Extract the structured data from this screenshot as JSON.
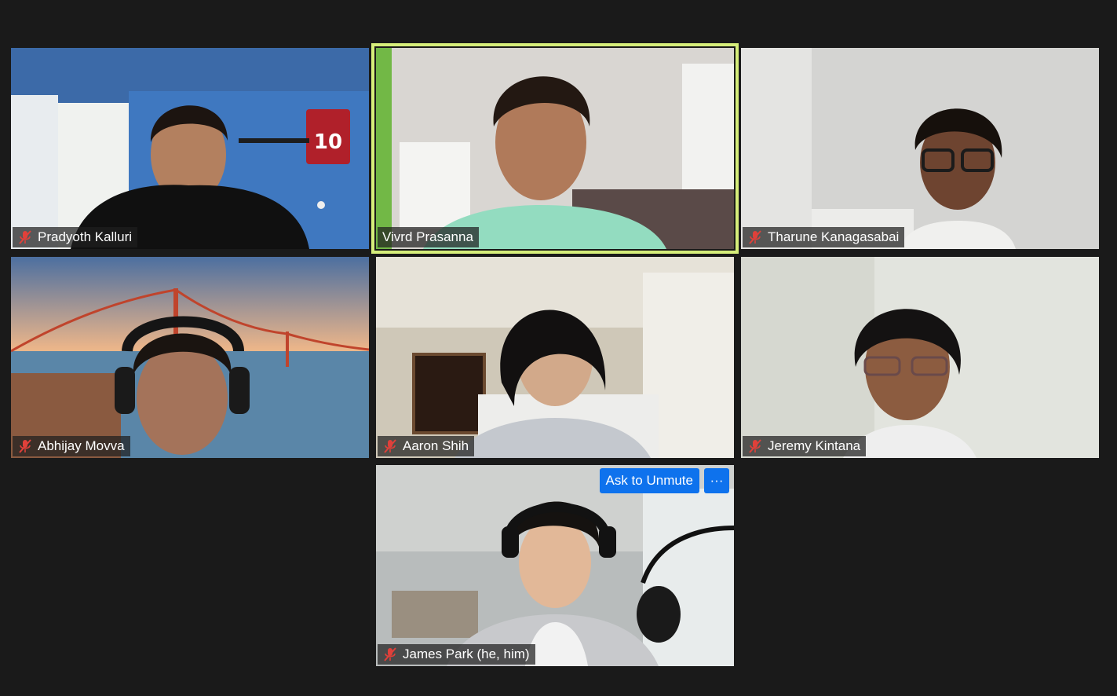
{
  "meeting": {
    "participants": [
      {
        "name": "Pradyoth Kalluri",
        "muted": true,
        "speaking": false
      },
      {
        "name": "Vivrd Prasanna",
        "muted": false,
        "speaking": true
      },
      {
        "name": "Tharune Kanagasabai",
        "muted": true,
        "speaking": false
      },
      {
        "name": "Abhijay Movva",
        "muted": true,
        "speaking": false
      },
      {
        "name": "Aaron Shih",
        "muted": true,
        "speaking": false
      },
      {
        "name": "Jeremy Kintana",
        "muted": true,
        "speaking": false
      },
      {
        "name": "James Park (he, him)",
        "muted": true,
        "speaking": false
      }
    ],
    "hover_controls": {
      "ask_to_unmute_label": "Ask to Unmute",
      "more_label": "···"
    }
  },
  "colors": {
    "background": "#1a1a1a",
    "speaking_border": "#d6ee7a",
    "mute_icon": "#e0403a",
    "button_blue": "#0e72ed"
  }
}
